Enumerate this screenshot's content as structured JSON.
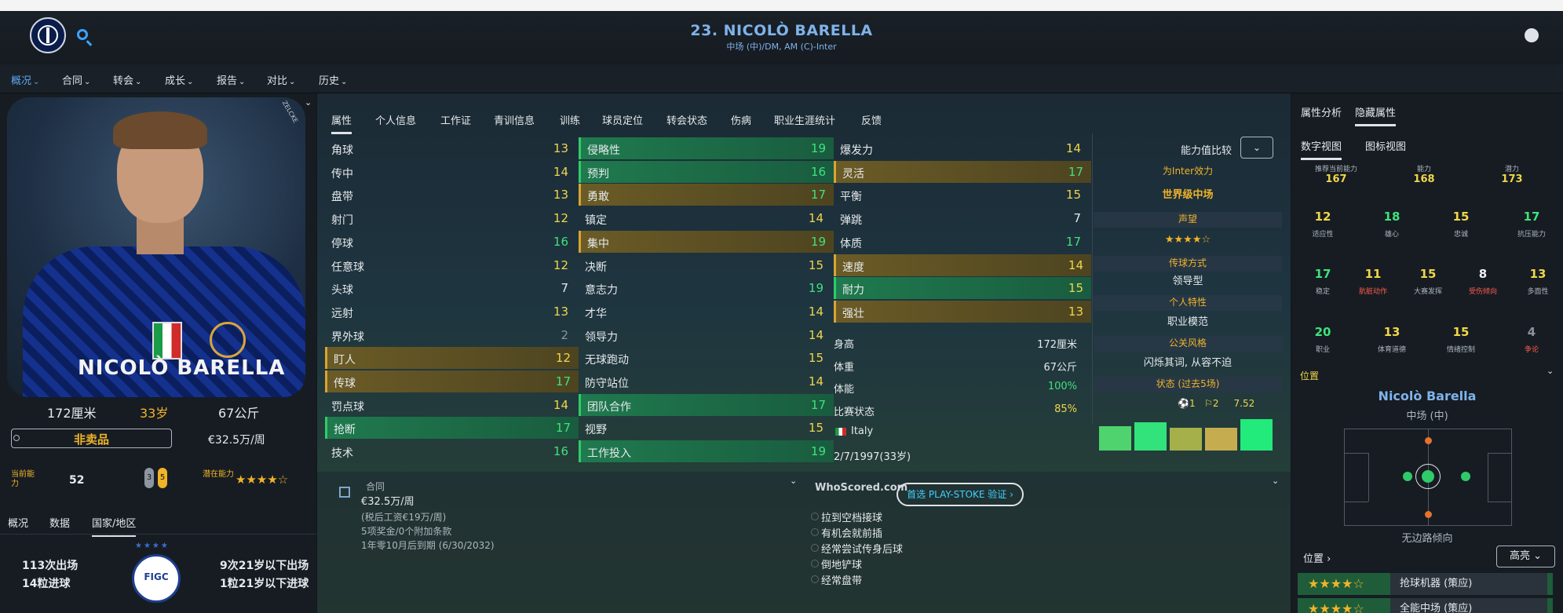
{
  "header": {
    "title": "23. NICOLÒ BARELLA",
    "subtitle": "中场 (中)/DM, AM (C)-Inter"
  },
  "menu": [
    {
      "label": "概况",
      "active": true
    },
    {
      "label": "合同"
    },
    {
      "label": "转会"
    },
    {
      "label": "成长"
    },
    {
      "label": "报告"
    },
    {
      "label": "对比"
    },
    {
      "label": "历史"
    }
  ],
  "profile": {
    "photo_name": "NICOLÒ BARELLA",
    "photo_tag": "ZELCKE",
    "height": "172厘米",
    "age": "33岁",
    "weight": "67公斤",
    "transfer_status": "非卖品",
    "wage": "€32.5万/周",
    "current_ability_label": "当前能力",
    "current_ability_value": "52",
    "pill_a": "3",
    "pill_b": "5",
    "potential_label": "潜在能力",
    "potential_stars": "★★★★☆"
  },
  "bottom_tabs": [
    "概况",
    "数据",
    "国家/地区"
  ],
  "national": {
    "caps": "113次出场",
    "goals": "14粒进球",
    "u21_caps": "9次21岁以下出场",
    "u21_goals": "1粒21岁以下进球",
    "badge": "FIGC",
    "badge_stars": "★★★★"
  },
  "center_tabs": [
    "属性",
    "个人信息",
    "工作证",
    "青训信息",
    "训练",
    "球员定位",
    "转会状态",
    "伤病",
    "职业生涯统计",
    "反馈"
  ],
  "technical": [
    {
      "name": "角球",
      "value": 13,
      "hl": ""
    },
    {
      "name": "传中",
      "value": 14,
      "hl": ""
    },
    {
      "name": "盘带",
      "value": 13,
      "hl": ""
    },
    {
      "name": "射门",
      "value": 12,
      "hl": ""
    },
    {
      "name": "停球",
      "value": 16,
      "hl": ""
    },
    {
      "name": "任意球",
      "value": 12,
      "hl": ""
    },
    {
      "name": "头球",
      "value": 7,
      "hl": ""
    },
    {
      "name": "远射",
      "value": 13,
      "hl": ""
    },
    {
      "name": "界外球",
      "value": 2,
      "hl": ""
    },
    {
      "name": "盯人",
      "value": 12,
      "hl": "yellow"
    },
    {
      "name": "传球",
      "value": 17,
      "hl": "yellow"
    },
    {
      "name": "罚点球",
      "value": 14,
      "hl": ""
    },
    {
      "name": "抢断",
      "value": 17,
      "hl": "green"
    },
    {
      "name": "技术",
      "value": 16,
      "hl": ""
    }
  ],
  "mental": [
    {
      "name": "侵略性",
      "value": 19,
      "hl": "green"
    },
    {
      "name": "预判",
      "value": 16,
      "hl": "green"
    },
    {
      "name": "勇敢",
      "value": 17,
      "hl": "yellow"
    },
    {
      "name": "镇定",
      "value": 14,
      "hl": ""
    },
    {
      "name": "集中",
      "value": 19,
      "hl": "yellow"
    },
    {
      "name": "决断",
      "value": 15,
      "hl": ""
    },
    {
      "name": "意志力",
      "value": 19,
      "hl": ""
    },
    {
      "name": "才华",
      "value": 14,
      "hl": ""
    },
    {
      "name": "领导力",
      "value": 14,
      "hl": ""
    },
    {
      "name": "无球跑动",
      "value": 15,
      "hl": ""
    },
    {
      "name": "防守站位",
      "value": 14,
      "hl": ""
    },
    {
      "name": "团队合作",
      "value": 17,
      "hl": "green"
    },
    {
      "name": "视野",
      "value": 15,
      "hl": ""
    },
    {
      "name": "工作投入",
      "value": 19,
      "hl": "green"
    }
  ],
  "physical": [
    {
      "name": "爆发力",
      "value": 14,
      "hl": ""
    },
    {
      "name": "灵活",
      "value": 17,
      "hl": "yellow"
    },
    {
      "name": "平衡",
      "value": 15,
      "hl": ""
    },
    {
      "name": "弹跳",
      "value": 7,
      "hl": ""
    },
    {
      "name": "体质",
      "value": 17,
      "hl": ""
    },
    {
      "name": "速度",
      "value": 14,
      "hl": "yellow"
    },
    {
      "name": "耐力",
      "value": 15,
      "hl": "green"
    },
    {
      "name": "强壮",
      "value": 13,
      "hl": "yellow"
    }
  ],
  "body_info": [
    {
      "name": "身高",
      "value": "172厘米",
      "color": ""
    },
    {
      "name": "体重",
      "value": "67公斤",
      "color": ""
    },
    {
      "name": "体能",
      "value": "100%",
      "color": "green"
    },
    {
      "name": "比赛状态",
      "value": "85%",
      "color": "yellow"
    },
    {
      "name": "Italy",
      "value": "",
      "color": ""
    },
    {
      "name": "2/7/1997(33岁)",
      "value": "",
      "color": ""
    }
  ],
  "side": {
    "compare_label": "能力值比较",
    "plays_for": "为Inter效力",
    "class": "世界级中场",
    "reputation_label": "声望",
    "reputation_stars": "★★★★☆",
    "passing_label": "传球方式",
    "passing_value": "领导型",
    "personality_label": "个人特性",
    "personality_value": "职业模范",
    "media_label": "公关风格",
    "media_value": "闪烁其词, 从容不迫",
    "form_label": "状态 (过去5场)",
    "form_goals": "1",
    "form_assists": "2",
    "form_rating": "7.52"
  },
  "form": [
    0.68,
    0.78,
    0.62,
    0.62,
    0.86
  ],
  "contract": {
    "title": "合同",
    "wage": "€32.5万/周",
    "pretax": "(税后工资€19万/周)",
    "bonuses": "5项奖金/0个附加条款",
    "expiry": "1年零10月后到期 (6/30/2032)"
  },
  "whoscored": {
    "logo": "WhoScored.com",
    "button": "首选 PLAY-STOKE 验证"
  },
  "traits": [
    "拉到空档接球",
    "有机会就前插",
    "经常尝试传身后球",
    "倒地铲球",
    "经常盘带"
  ],
  "right_tabs": {
    "top": [
      "属性分析",
      "隐藏属性"
    ],
    "sub": [
      "数字视图",
      "图标视图"
    ]
  },
  "ability": [
    {
      "label": "推荐当前能力",
      "value": "167"
    },
    {
      "label": "能力",
      "value": "168"
    },
    {
      "label": "潜力",
      "value": "173"
    }
  ],
  "hidden": [
    {
      "label": "适应性",
      "value": "12",
      "color": "yellow"
    },
    {
      "label": "雄心",
      "value": "18",
      "color": "green"
    },
    {
      "label": "忠诚",
      "value": "15",
      "color": "yellow"
    },
    {
      "label": "抗压能力",
      "value": "17",
      "color": "green"
    },
    {
      "label": "稳定",
      "value": "17",
      "color": "green"
    },
    {
      "label": "肮脏动作",
      "value": "11",
      "color": "yellow",
      "label_color": "red"
    },
    {
      "label": "大赛发挥",
      "value": "15",
      "color": "yellow"
    },
    {
      "label": "受伤倾向",
      "value": "8",
      "color": "white",
      "label_color": "red"
    },
    {
      "label": "多面性",
      "value": "13",
      "color": "yellow"
    },
    {
      "label": "职业",
      "value": "20",
      "color": "green"
    },
    {
      "label": "体育道德",
      "value": "13",
      "color": "yellow"
    },
    {
      "label": "情绪控制",
      "value": "15",
      "color": "yellow"
    },
    {
      "label": "争论",
      "value": "4",
      "color": "grey",
      "label_color": "red"
    }
  ],
  "position": {
    "header": "位置",
    "name": "Nicolò Barella",
    "role": "中场 (中)",
    "pitch_label": "无边路倾向",
    "link": "位置 ›",
    "bright_btn": "高亮"
  },
  "roles": [
    {
      "stars": "★★★★☆",
      "name": "抢球机器 (策应)"
    },
    {
      "stars": "★★★★☆",
      "name": "全能中场 (策应)"
    }
  ],
  "colors": {
    "accent": "#5aa8f0",
    "gold": "#f0b429",
    "green": "#3fe27c",
    "yellow_row": "#6b5b26",
    "green_row": "#1f7a4e"
  }
}
